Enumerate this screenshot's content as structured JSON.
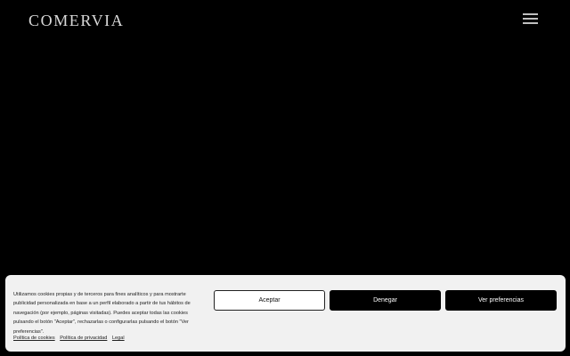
{
  "header": {
    "logo_text": "COMERVIA",
    "menu_icon": "hamburger-menu-icon"
  },
  "cookie_banner": {
    "message": "Utilizamos cookies propias y de terceros para fines analíticos y para mostrarte publicidad personalizada en base a un perfil elaborado a partir de tus hábitos de navegación (por ejemplo, páginas visitadas). Puedes aceptar todas las cookies pulsando el botón \"Aceptar\", rechazarlas o configurarlas pulsando el botón \"Ver preferencias\".",
    "buttons": {
      "accept": "Aceptar",
      "deny": "Denegar",
      "preferences": "Ver preferencias"
    },
    "links": {
      "cookies_policy": "Política de cookies",
      "privacy_policy": "Política de privacidad",
      "legal": "Legal"
    }
  },
  "colors": {
    "background": "#000000",
    "banner_background": "#f1f1f1",
    "logo": "#d9d9d9"
  }
}
